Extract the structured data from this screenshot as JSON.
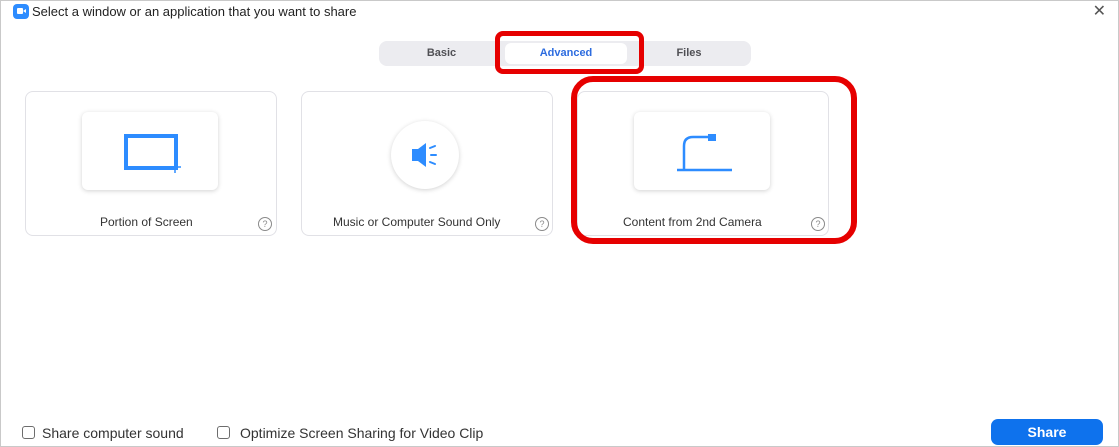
{
  "window": {
    "title": "Select a window or an application that you want to share",
    "close_glyph": "✕"
  },
  "tabs": [
    {
      "label": "Basic",
      "selected": false
    },
    {
      "label": "Advanced",
      "selected": true
    },
    {
      "label": "Files",
      "selected": false
    }
  ],
  "options": [
    {
      "label": "Portion of Screen",
      "icon": "portion-of-screen-icon",
      "help": "?"
    },
    {
      "label": "Music or Computer Sound Only",
      "icon": "speaker-icon",
      "help": "?"
    },
    {
      "label": "Content from 2nd Camera",
      "icon": "document-camera-icon",
      "help": "?"
    }
  ],
  "footer": {
    "share_sound_label": "Share computer sound",
    "share_sound_checked": false,
    "optimize_label": "Optimize Screen Sharing for Video Clip",
    "optimize_checked": false,
    "share_button": "Share"
  },
  "colors": {
    "accent": "#2d8cff",
    "share_button": "#0e72ed",
    "annotation_red": "#e60000",
    "selected_tab_text": "#2d6cdf"
  }
}
